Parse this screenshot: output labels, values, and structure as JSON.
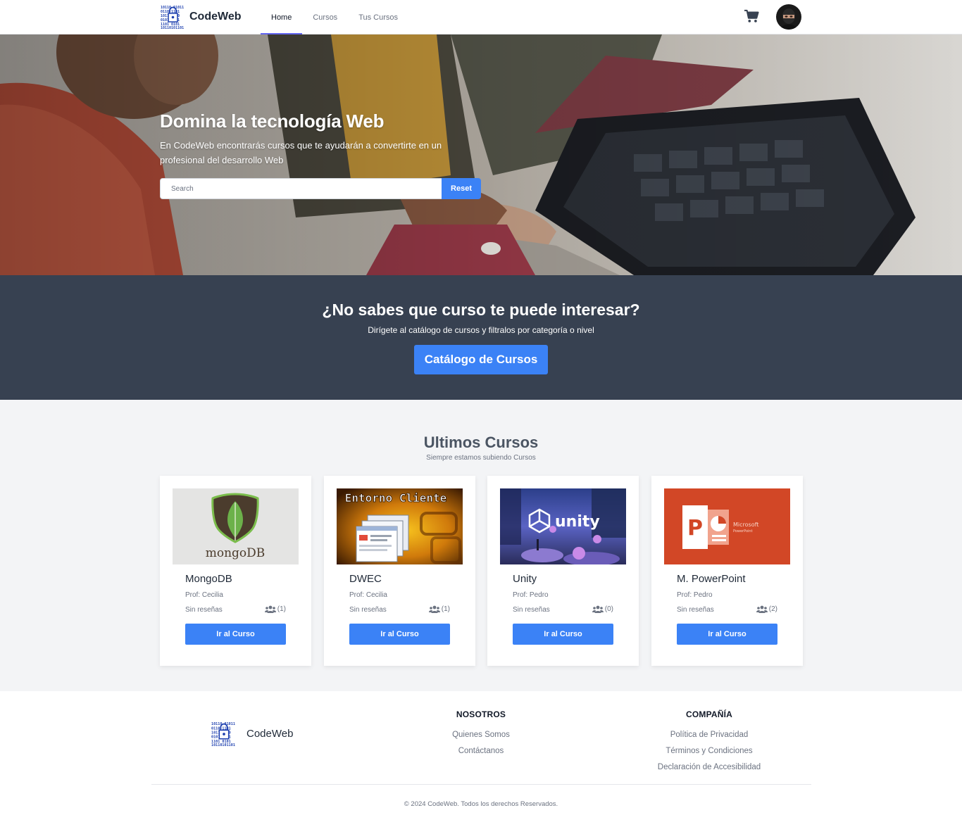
{
  "nav": {
    "brand": "CodeWeb",
    "links": [
      {
        "label": "Home",
        "active": true
      },
      {
        "label": "Cursos",
        "active": false
      },
      {
        "label": "Tus Cursos",
        "active": false
      }
    ],
    "cart_icon": "cart-icon",
    "accent": "#6366f1"
  },
  "hero": {
    "title": "Domina la tecnología Web",
    "subtitle": "En CodeWeb encontrarás cursos que te ayudarán a convertirte en un profesional del desarrollo Web",
    "search_placeholder": "Search",
    "search_value": "",
    "reset_label": "Reset"
  },
  "cta": {
    "title": "¿No sabes que curso te puede interesar?",
    "subtitle": "Dirígete al catálogo de cursos y filtralos por categoría o nivel",
    "button": "Catálogo de Cursos",
    "bg": "#374151"
  },
  "courses": {
    "title": "Ultimos Cursos",
    "subtitle": "Siempre estamos subiendo Cursos",
    "button_label": "Ir al Curso",
    "items": [
      {
        "title": "MongoDB",
        "prof": "Prof: Cecilia",
        "reviews": "Sin reseñas",
        "students": "(1)",
        "image_label": "mongoDB"
      },
      {
        "title": "DWEC",
        "prof": "Prof: Cecilia",
        "reviews": "Sin reseñas",
        "students": "(1)",
        "image_label": "Entorno Cliente"
      },
      {
        "title": "Unity",
        "prof": "Prof: Pedro",
        "reviews": "Sin reseñas",
        "students": "(0)",
        "image_label": "unity"
      },
      {
        "title": "M. PowerPoint",
        "prof": "Prof: Pedro",
        "reviews": "Sin reseñas",
        "students": "(2)",
        "image_label_1": "Microsoft",
        "image_label_2": "PowerPoint"
      }
    ]
  },
  "footer": {
    "brand": "CodeWeb",
    "col1": {
      "heading": "NOSOTROS",
      "links": [
        "Quienes Somos",
        "Contáctanos"
      ]
    },
    "col2": {
      "heading": "COMPAÑÍA",
      "links": [
        "Política de Privacidad",
        "Términos y Condiciones",
        "Declaración de Accesibilidad"
      ]
    },
    "copyright": "© 2024 CodeWeb. Todos los derechos Reservados."
  },
  "colors": {
    "primary": "#3b82f6",
    "cta_bg": "#374151",
    "section_bg": "#f3f4f6"
  }
}
